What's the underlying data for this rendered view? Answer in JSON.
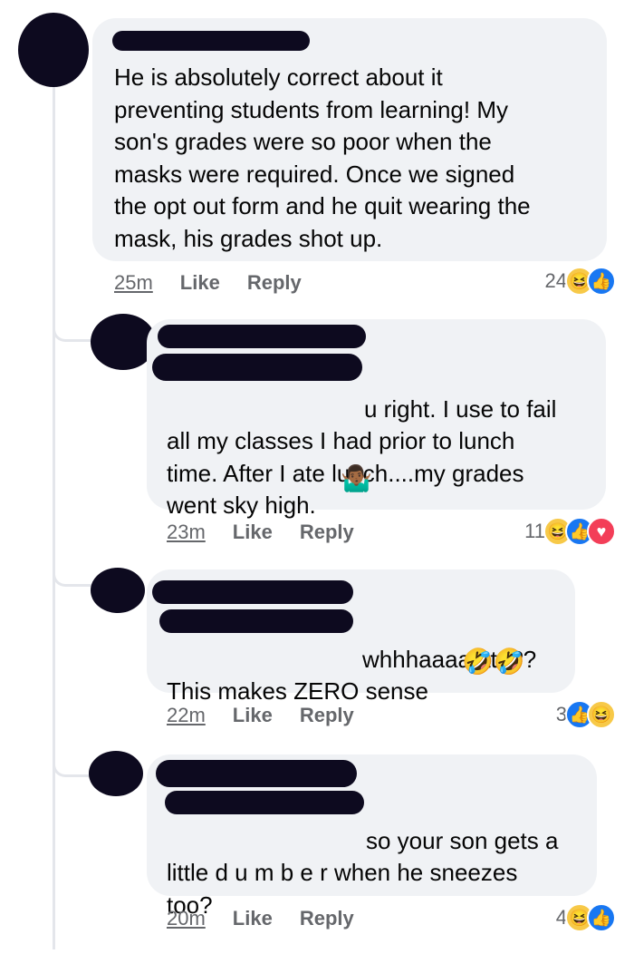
{
  "comments": [
    {
      "text": "He is absolutely correct about it\npreventing students from learning! My\nson's grades were so poor when the\nmasks were required. Once we signed\nthe opt out form and he quit wearing the\nmask, his grades shot up.",
      "time": "25m",
      "like": "Like",
      "reply": "Reply",
      "reactions_count": "24",
      "reactions": [
        "haha-icon",
        "like-icon"
      ]
    },
    {
      "text": "u right.  I use to fail\nall my classes I had prior to lunch\ntime.  After I ate lunch....my grades\nwent sky high.",
      "emoji": "🤷🏾‍♂️",
      "time": "23m",
      "like": "Like",
      "reply": "Reply",
      "reactions_count": "11",
      "reactions": [
        "haha-icon",
        "like-icon",
        "love-icon"
      ]
    },
    {
      "text": "whhhaaaatttt???\nThis makes ZERO sense",
      "emoji": "🤣🤣",
      "time": "22m",
      "like": "Like",
      "reply": "Reply",
      "reactions_count": "3",
      "reactions": [
        "like-icon",
        "haha-icon"
      ]
    },
    {
      "text": "so your son gets a\nlittle d u m b e r when he sneezes\ntoo?",
      "time": "20m",
      "like": "Like",
      "reply": "Reply",
      "reactions_count": "4",
      "reactions": [
        "haha-icon",
        "like-icon"
      ]
    }
  ],
  "reaction_glyphs": {
    "haha": "😆",
    "like": "👍",
    "love": "♥"
  },
  "colors": {
    "bubble": "#f0f2f5",
    "like_blue": "#1877f2",
    "love_red": "#f33e58",
    "meta_gray": "#65676b",
    "redaction": "#0d0a1f"
  }
}
